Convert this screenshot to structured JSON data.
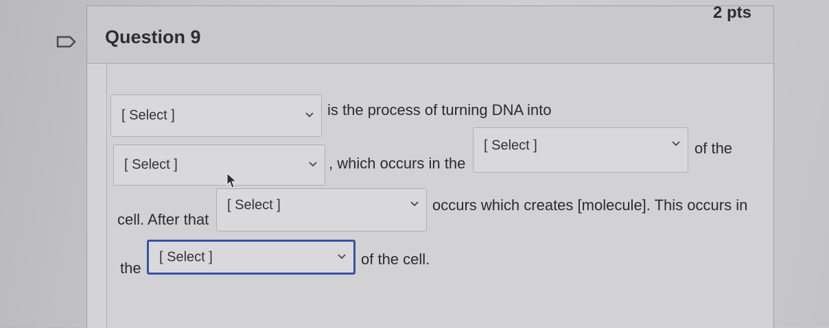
{
  "question": {
    "title": "Question 9",
    "points": "2 pts"
  },
  "sentence": {
    "t1": "is the process of turning DNA into",
    "t2": ", which occurs in the",
    "t3": "of the",
    "t4": "cell. After that",
    "t5": "occurs which creates [molecule]. This occurs in",
    "t6": "the",
    "t7": "of the cell."
  },
  "dropdowns": [
    {
      "selected": "[ Select ]"
    },
    {
      "selected": "[ Select ]"
    },
    {
      "selected": "[ Select ]"
    },
    {
      "selected": "[ Select ]"
    },
    {
      "selected": "[ Select ]"
    }
  ],
  "icons": {
    "flag": "bookmark-flag-icon",
    "chevron": "chevron-down-icon",
    "cursor": "mouse-pointer-icon"
  },
  "colors": {
    "focus_border": "#3550a6"
  }
}
